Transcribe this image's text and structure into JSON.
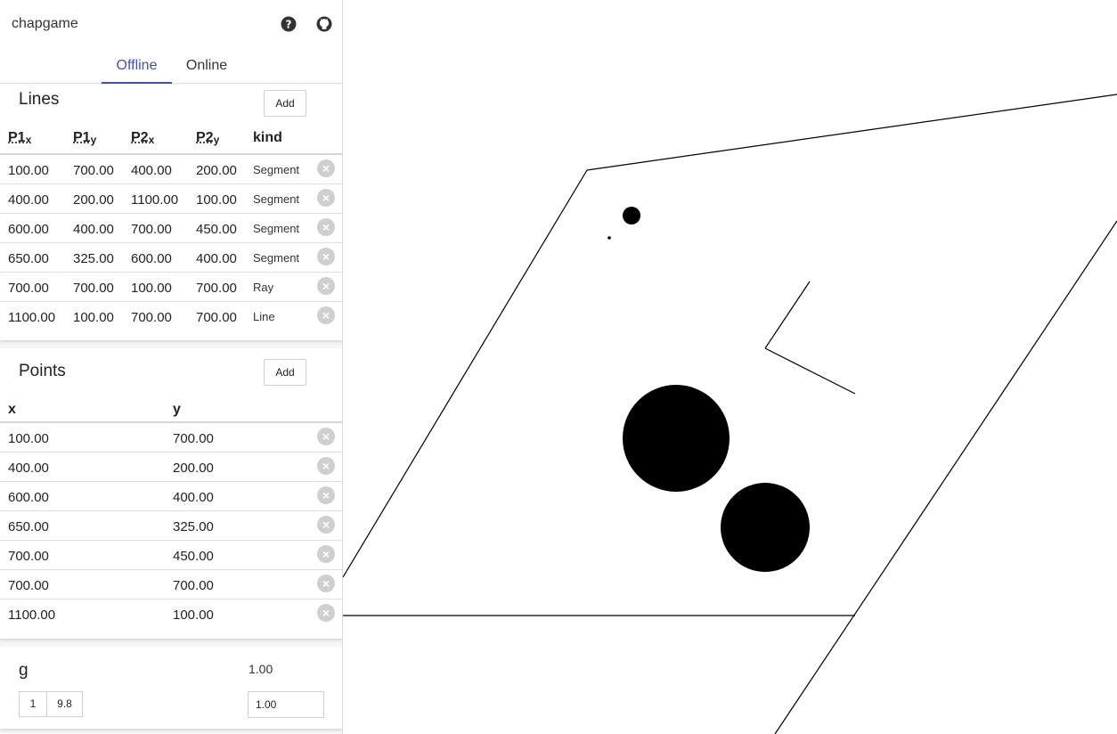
{
  "app": {
    "title": "chapgame"
  },
  "icons": {
    "help": "help-circle-icon",
    "github": "github-icon",
    "remove": "close-circle-icon"
  },
  "tabs": [
    {
      "label": "Offline",
      "active": true
    },
    {
      "label": "Online",
      "active": false
    }
  ],
  "lines": {
    "title": "Lines",
    "add_label": "Add",
    "headers": {
      "p1x": "P1",
      "p1x_sub": "x",
      "p1y": "P1",
      "p1y_sub": "y",
      "p2x": "P2",
      "p2x_sub": "x",
      "p2y": "P2",
      "p2y_sub": "y",
      "kind": "kind"
    },
    "rows": [
      {
        "p1x": "100.00",
        "p1y": "700.00",
        "p2x": "400.00",
        "p2y": "200.00",
        "kind": "Segment"
      },
      {
        "p1x": "400.00",
        "p1y": "200.00",
        "p2x": "1100.00",
        "p2y": "100.00",
        "kind": "Segment"
      },
      {
        "p1x": "600.00",
        "p1y": "400.00",
        "p2x": "700.00",
        "p2y": "450.00",
        "kind": "Segment"
      },
      {
        "p1x": "650.00",
        "p1y": "325.00",
        "p2x": "600.00",
        "p2y": "400.00",
        "kind": "Segment"
      },
      {
        "p1x": "700.00",
        "p1y": "700.00",
        "p2x": "100.00",
        "p2y": "700.00",
        "kind": "Ray"
      },
      {
        "p1x": "1100.00",
        "p1y": "100.00",
        "p2x": "700.00",
        "p2y": "700.00",
        "kind": "Line"
      }
    ]
  },
  "points": {
    "title": "Points",
    "add_label": "Add",
    "headers": {
      "x": "x",
      "y": "y"
    },
    "rows": [
      {
        "x": "100.00",
        "y": "700.00"
      },
      {
        "x": "400.00",
        "y": "200.00"
      },
      {
        "x": "600.00",
        "y": "400.00"
      },
      {
        "x": "650.00",
        "y": "325.00"
      },
      {
        "x": "700.00",
        "y": "450.00"
      },
      {
        "x": "700.00",
        "y": "700.00"
      },
      {
        "x": "1100.00",
        "y": "100.00"
      }
    ]
  },
  "gravity": {
    "label": "g",
    "value": "1.00",
    "preset_1": "1",
    "preset_2": "9.8",
    "input_value": "1.00"
  },
  "colors": {
    "accent": "#3f51b5",
    "remove_button": "#cfcfcf",
    "ink": "#000000"
  }
}
